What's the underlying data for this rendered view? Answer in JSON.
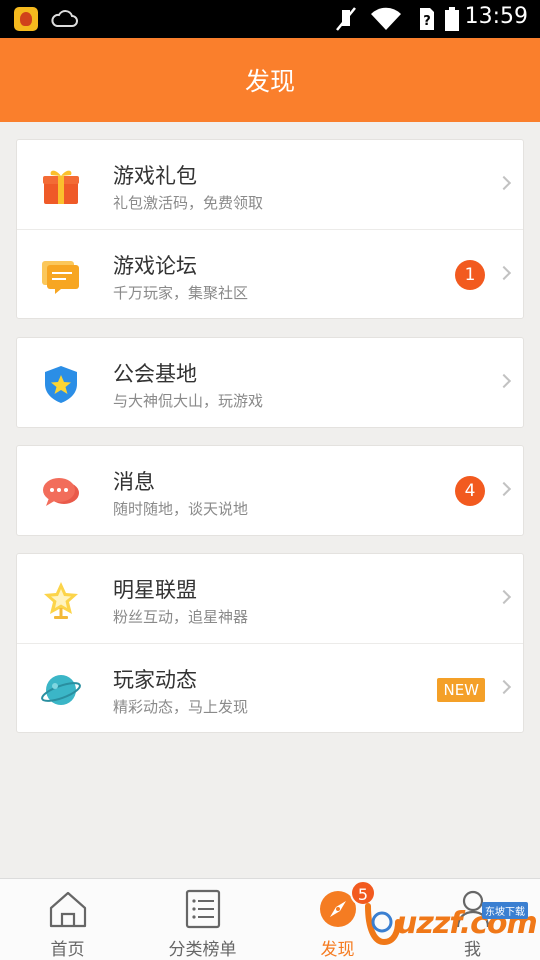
{
  "status_bar": {
    "time": "13:59",
    "app_icon": "game-app-icon",
    "icons": [
      "cloud-icon",
      "mute-icon",
      "wifi-icon",
      "sim-unknown-icon",
      "battery-icon"
    ]
  },
  "header": {
    "title": "发现"
  },
  "sections": [
    {
      "items": [
        {
          "title": "游戏礼包",
          "subtitle": "礼包激活码，免费领取",
          "icon": "gift-icon"
        },
        {
          "title": "游戏论坛",
          "subtitle": "千万玩家，集聚社区",
          "icon": "forum-icon",
          "badge": "1"
        }
      ]
    },
    {
      "items": [
        {
          "title": "公会基地",
          "subtitle": "与大神侃大山，玩游戏",
          "icon": "guild-shield-icon"
        }
      ]
    },
    {
      "items": [
        {
          "title": "消息",
          "subtitle": "随时随地，谈天说地",
          "icon": "chat-bubbles-icon",
          "badge": "4"
        }
      ]
    },
    {
      "items": [
        {
          "title": "明星联盟",
          "subtitle": "粉丝互动，追星神器",
          "icon": "star-trophy-icon"
        },
        {
          "title": "玩家动态",
          "subtitle": "精彩动态，马上发现",
          "icon": "planet-icon",
          "tag": "NEW"
        }
      ]
    }
  ],
  "tab_bar": {
    "tabs": [
      {
        "label": "首页",
        "icon": "home-icon"
      },
      {
        "label": "分类榜单",
        "icon": "list-icon"
      },
      {
        "label": "发现",
        "icon": "compass-icon",
        "badge": "5",
        "active": true
      },
      {
        "label": "我",
        "icon": "person-icon"
      }
    ]
  },
  "watermark": {
    "text": "uzzf.com",
    "tag": "东坡下载"
  },
  "colors": {
    "accent": "#fa7f2c",
    "badge": "#f25a1f",
    "new_tag": "#f4a028"
  }
}
